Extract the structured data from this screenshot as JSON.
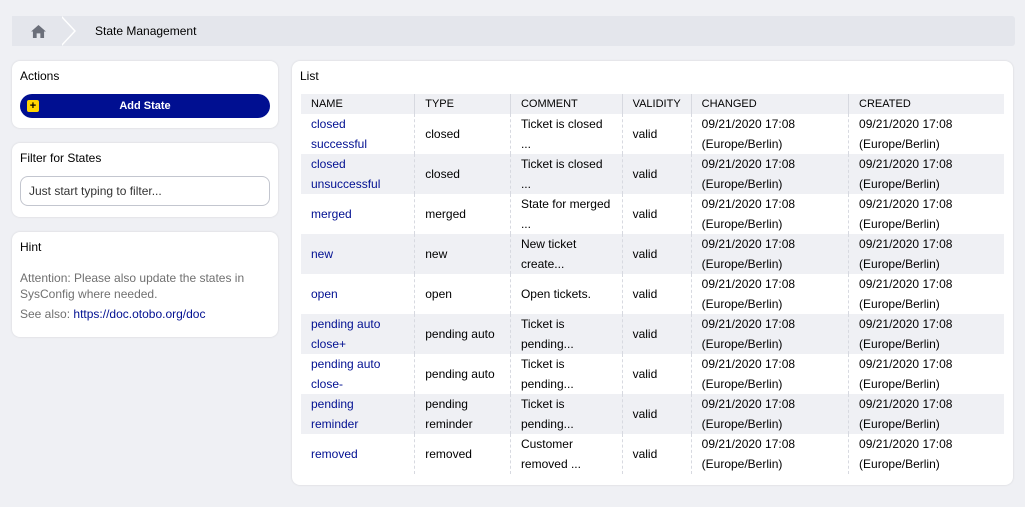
{
  "breadcrumb": {
    "current": "State Management"
  },
  "actions": {
    "title": "Actions",
    "add_label": "Add State"
  },
  "filter": {
    "title": "Filter for States",
    "placeholder": "Just start typing to filter..."
  },
  "hint": {
    "title": "Hint",
    "text": "Attention: Please also update the states in SysConfig where needed.",
    "see_also_label": "See also:",
    "link": "https://doc.otobo.org/doc"
  },
  "list": {
    "title": "List",
    "columns": [
      "NAME",
      "TYPE",
      "COMMENT",
      "VALIDITY",
      "CHANGED",
      "CREATED"
    ],
    "rows": [
      {
        "name": "closed successful",
        "type": "closed",
        "comment": "Ticket is closed ...",
        "validity": "valid",
        "changed": "09/21/2020 17:08 (Europe/Berlin)",
        "created": "09/21/2020 17:08 (Europe/Berlin)"
      },
      {
        "name": "closed unsuccessful",
        "type": "closed",
        "comment": "Ticket is closed ...",
        "validity": "valid",
        "changed": "09/21/2020 17:08 (Europe/Berlin)",
        "created": "09/21/2020 17:08 (Europe/Berlin)"
      },
      {
        "name": "merged",
        "type": "merged",
        "comment": "State for merged ...",
        "validity": "valid",
        "changed": "09/21/2020 17:08 (Europe/Berlin)",
        "created": "09/21/2020 17:08 (Europe/Berlin)"
      },
      {
        "name": "new",
        "type": "new",
        "comment": "New ticket create...",
        "validity": "valid",
        "changed": "09/21/2020 17:08 (Europe/Berlin)",
        "created": "09/21/2020 17:08 (Europe/Berlin)"
      },
      {
        "name": "open",
        "type": "open",
        "comment": "Open tickets.",
        "validity": "valid",
        "changed": "09/21/2020 17:08 (Europe/Berlin)",
        "created": "09/21/2020 17:08 (Europe/Berlin)"
      },
      {
        "name": "pending auto close+",
        "type": "pending auto",
        "comment": "Ticket is pending...",
        "validity": "valid",
        "changed": "09/21/2020 17:08 (Europe/Berlin)",
        "created": "09/21/2020 17:08 (Europe/Berlin)"
      },
      {
        "name": "pending auto close-",
        "type": "pending auto",
        "comment": "Ticket is pending...",
        "validity": "valid",
        "changed": "09/21/2020 17:08 (Europe/Berlin)",
        "created": "09/21/2020 17:08 (Europe/Berlin)"
      },
      {
        "name": "pending reminder",
        "type": "pending reminder",
        "comment": "Ticket is pending...",
        "validity": "valid",
        "changed": "09/21/2020 17:08 (Europe/Berlin)",
        "created": "09/21/2020 17:08 (Europe/Berlin)"
      },
      {
        "name": "removed",
        "type": "removed",
        "comment": "Customer removed ...",
        "validity": "valid",
        "changed": "09/21/2020 17:08 (Europe/Berlin)",
        "created": "09/21/2020 17:08 (Europe/Berlin)"
      }
    ]
  },
  "colors": {
    "accent": "#000f91",
    "plus_icon": "#ffd400",
    "background": "#eff0f4"
  }
}
